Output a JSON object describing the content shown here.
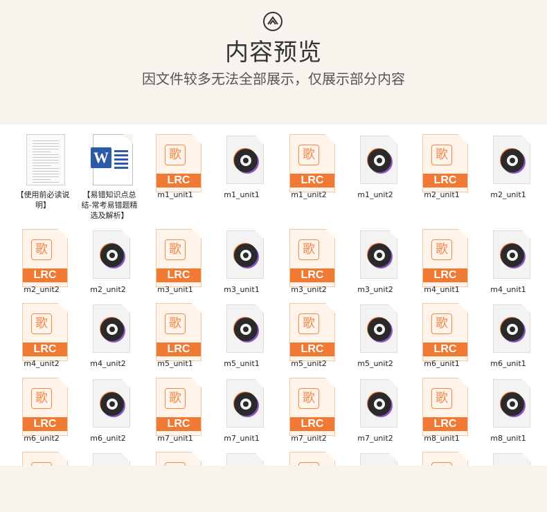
{
  "header": {
    "title": "内容预览",
    "subtitle": "因文件较多无法全部展示，仅展示部分内容",
    "logo_icon": "chevron-up-circle-icon"
  },
  "colors": {
    "background": "#f7f4ee",
    "panel": "#ffffff",
    "lrc_accent": "#f07a33",
    "word_blue": "#2b5aa8"
  },
  "files": [
    {
      "name": "【使用前必读说明】",
      "kind": "txt"
    },
    {
      "name": "【易错知识点总结-常考易错题精选及解析】",
      "kind": "word"
    },
    {
      "name": "m1_unit1",
      "kind": "lrc"
    },
    {
      "name": "m1_unit1",
      "kind": "audio"
    },
    {
      "name": "m1_unit2",
      "kind": "lrc"
    },
    {
      "name": "m1_unit2",
      "kind": "audio"
    },
    {
      "name": "m2_unit1",
      "kind": "lrc"
    },
    {
      "name": "m2_unit1",
      "kind": "audio"
    },
    {
      "name": "m2_unit2",
      "kind": "lrc"
    },
    {
      "name": "m2_unit2",
      "kind": "audio"
    },
    {
      "name": "m3_unit1",
      "kind": "lrc"
    },
    {
      "name": "m3_unit1",
      "kind": "audio"
    },
    {
      "name": "m3_unit2",
      "kind": "lrc"
    },
    {
      "name": "m3_unit2",
      "kind": "audio"
    },
    {
      "name": "m4_unit1",
      "kind": "lrc"
    },
    {
      "name": "m4_unit1",
      "kind": "audio"
    },
    {
      "name": "m4_unit2",
      "kind": "lrc"
    },
    {
      "name": "m4_unit2",
      "kind": "audio"
    },
    {
      "name": "m5_unit1",
      "kind": "lrc"
    },
    {
      "name": "m5_unit1",
      "kind": "audio"
    },
    {
      "name": "m5_unit2",
      "kind": "lrc"
    },
    {
      "name": "m5_unit2",
      "kind": "audio"
    },
    {
      "name": "m6_unit1",
      "kind": "lrc"
    },
    {
      "name": "m6_unit1",
      "kind": "audio"
    },
    {
      "name": "m6_unit2",
      "kind": "lrc"
    },
    {
      "name": "m6_unit2",
      "kind": "audio"
    },
    {
      "name": "m7_unit1",
      "kind": "lrc"
    },
    {
      "name": "m7_unit1",
      "kind": "audio"
    },
    {
      "name": "m7_unit2",
      "kind": "lrc"
    },
    {
      "name": "m7_unit2",
      "kind": "audio"
    },
    {
      "name": "m8_unit1",
      "kind": "lrc"
    },
    {
      "name": "m8_unit1",
      "kind": "audio"
    },
    {
      "name": "",
      "kind": "lrc"
    },
    {
      "name": "",
      "kind": "audio"
    },
    {
      "name": "",
      "kind": "lrc"
    },
    {
      "name": "",
      "kind": "audio"
    },
    {
      "name": "",
      "kind": "lrc"
    },
    {
      "name": "",
      "kind": "audio"
    },
    {
      "name": "",
      "kind": "lrc"
    },
    {
      "name": "",
      "kind": "audio"
    }
  ],
  "lrc_icon": {
    "char": "歌",
    "band": "LRC"
  }
}
